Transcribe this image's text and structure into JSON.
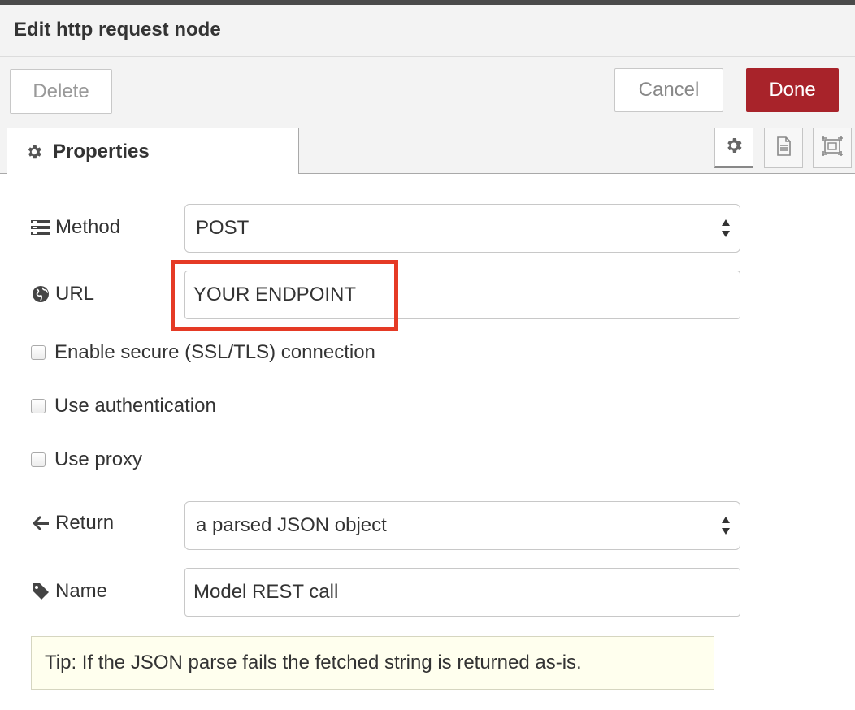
{
  "dialog": {
    "title": "Edit http request node",
    "buttons": {
      "delete": "Delete",
      "cancel": "Cancel",
      "done": "Done"
    },
    "accent_color": "#a8232a"
  },
  "tabs": {
    "properties": {
      "label": "Properties",
      "icon": "gear-icon"
    },
    "icon_tabs": [
      "gear-icon",
      "document-icon",
      "frame-icon"
    ]
  },
  "form": {
    "method": {
      "label": "Method",
      "value": "POST",
      "icon": "list-icon"
    },
    "url": {
      "label": "URL",
      "value": "YOUR ENDPOINT",
      "icon": "globe-icon"
    },
    "checkboxes": [
      {
        "label": "Enable secure (SSL/TLS) connection",
        "checked": false
      },
      {
        "label": "Use authentication",
        "checked": false
      },
      {
        "label": "Use proxy",
        "checked": false
      }
    ],
    "return": {
      "label": "Return",
      "value": "a parsed JSON object",
      "icon": "arrow-left-icon"
    },
    "name": {
      "label": "Name",
      "value": "Model REST call",
      "icon": "tag-icon"
    },
    "tip": "Tip: If the JSON parse fails the fetched string is returned as-is."
  },
  "highlight_color": "#e53a25"
}
